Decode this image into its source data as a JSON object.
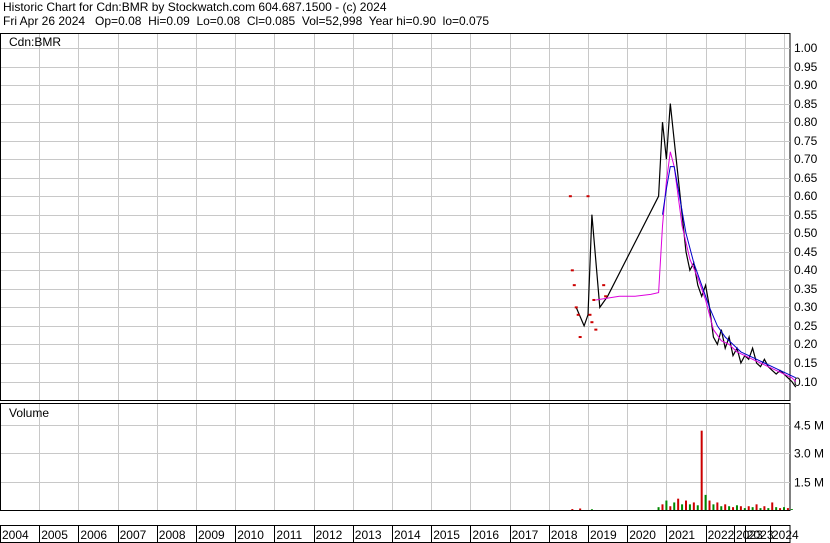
{
  "header": {
    "line1": "Historic Chart for Cdn:BMR by Stockwatch.com 604.687.1500 - (c) 2024",
    "line2": "Fri Apr 26 2024   Op=0.08  Hi=0.09  Lo=0.08  Cl=0.085  Vol=52,998  Year hi=0.90  lo=0.075"
  },
  "chart_data": [
    {
      "type": "line",
      "title": "Cdn:BMR",
      "ylim": [
        0.05,
        1.0
      ],
      "y_ticks": [
        "1.00",
        "0.95",
        "0.90",
        "0.85",
        "0.80",
        "0.75",
        "0.70",
        "0.65",
        "0.60",
        "0.55",
        "0.50",
        "0.45",
        "0.40",
        "0.35",
        "0.30",
        "0.25",
        "0.20",
        "0.15",
        "0.10"
      ],
      "x_ticks": [
        "2004",
        "2005",
        "2006",
        "2007",
        "2008",
        "2009",
        "2010",
        "2011",
        "2012",
        "2013",
        "2014",
        "2015",
        "2016",
        "2017",
        "2018",
        "2019",
        "2020",
        "2021",
        "2022",
        "2023",
        "2023",
        "2024"
      ],
      "grid": true,
      "series": [
        {
          "color": "#000000",
          "x": [
            2018.7,
            2018.9,
            2019.0,
            2019.1,
            2019.3,
            2019.5,
            2020.8,
            2020.9,
            2021.0,
            2021.1,
            2021.2,
            2021.3,
            2021.4,
            2021.5,
            2021.6,
            2021.7,
            2021.8,
            2021.9,
            2022.0,
            2022.1,
            2022.2,
            2022.3,
            2022.4,
            2022.5,
            2022.6,
            2022.7,
            2022.8,
            2022.9,
            2023.0,
            2023.1,
            2023.2,
            2023.3,
            2023.4,
            2023.5,
            2023.6,
            2023.7,
            2023.8,
            2023.9,
            2024.0,
            2024.1,
            2024.2,
            2024.3
          ],
          "y": [
            0.3,
            0.25,
            0.28,
            0.55,
            0.3,
            0.33,
            0.6,
            0.8,
            0.7,
            0.85,
            0.75,
            0.65,
            0.55,
            0.45,
            0.4,
            0.42,
            0.36,
            0.33,
            0.36,
            0.3,
            0.22,
            0.2,
            0.24,
            0.19,
            0.22,
            0.17,
            0.19,
            0.15,
            0.17,
            0.16,
            0.19,
            0.15,
            0.14,
            0.16,
            0.14,
            0.13,
            0.12,
            0.13,
            0.12,
            0.11,
            0.1,
            0.085
          ]
        },
        {
          "color": "#dd00dd",
          "x": [
            2019.2,
            2019.5,
            2019.8,
            2020.2,
            2020.6,
            2020.8,
            2020.9,
            2021.0,
            2021.1,
            2021.2,
            2021.4,
            2021.6,
            2021.8,
            2022.0,
            2022.2,
            2022.4,
            2022.6,
            2022.8,
            2023.0,
            2023.2,
            2023.4,
            2023.6,
            2023.8,
            2024.0,
            2024.2,
            2024.3
          ],
          "y": [
            0.32,
            0.325,
            0.33,
            0.33,
            0.335,
            0.34,
            0.52,
            0.64,
            0.72,
            0.68,
            0.52,
            0.43,
            0.38,
            0.32,
            0.24,
            0.21,
            0.2,
            0.18,
            0.17,
            0.16,
            0.15,
            0.14,
            0.13,
            0.12,
            0.11,
            0.1
          ]
        },
        {
          "color": "#0000cc",
          "x": [
            2020.9,
            2021.0,
            2021.1,
            2021.2,
            2021.3,
            2021.5,
            2021.7,
            2021.9,
            2022.1,
            2022.3,
            2022.5,
            2022.7,
            2022.9,
            2023.1,
            2023.3,
            2023.5,
            2023.7,
            2023.9,
            2024.1,
            2024.3
          ],
          "y": [
            0.55,
            0.62,
            0.68,
            0.68,
            0.62,
            0.5,
            0.42,
            0.36,
            0.3,
            0.25,
            0.22,
            0.2,
            0.18,
            0.17,
            0.16,
            0.15,
            0.14,
            0.13,
            0.12,
            0.11
          ]
        }
      ],
      "markers": {
        "color": "#cc0000",
        "x": [
          2018.55,
          2018.6,
          2018.65,
          2018.7,
          2018.75,
          2018.8,
          2019.0,
          2019.05,
          2019.1,
          2019.15,
          2019.2,
          2019.4,
          2019.45
        ],
        "y": [
          0.6,
          0.4,
          0.36,
          0.3,
          0.28,
          0.22,
          0.6,
          0.28,
          0.26,
          0.32,
          0.24,
          0.36,
          0.33
        ]
      }
    },
    {
      "type": "bar",
      "title": "Volume",
      "y_ticks": [
        "4.5 M",
        "3.0 M",
        "1.5 M"
      ],
      "ylim": [
        0,
        5.6
      ],
      "x": [
        2018.6,
        2018.8,
        2019.1,
        2020.8,
        2020.9,
        2021.0,
        2021.1,
        2021.2,
        2021.3,
        2021.4,
        2021.5,
        2021.6,
        2021.7,
        2021.8,
        2021.9,
        2022.0,
        2022.1,
        2022.2,
        2022.3,
        2022.4,
        2022.5,
        2022.6,
        2022.7,
        2022.8,
        2022.9,
        2023.0,
        2023.1,
        2023.2,
        2023.3,
        2023.4,
        2023.5,
        2023.6,
        2023.7,
        2023.8,
        2023.9,
        2024.0,
        2024.1,
        2024.2
      ],
      "values": [
        0.05,
        0.08,
        0.04,
        0.15,
        0.3,
        0.5,
        0.2,
        0.4,
        0.6,
        0.3,
        0.5,
        0.3,
        0.4,
        0.25,
        4.2,
        0.8,
        0.5,
        0.3,
        0.4,
        0.2,
        0.3,
        0.2,
        0.15,
        0.25,
        0.2,
        0.1,
        0.2,
        0.15,
        0.3,
        0.1,
        0.2,
        0.1,
        0.4,
        0.15,
        0.1,
        0.15,
        0.1,
        0.05
      ],
      "colors": [
        "#cc0000",
        "#cc0000",
        "#008800",
        "#008800",
        "#cc0000",
        "#008800",
        "#cc0000",
        "#008800",
        "#cc0000",
        "#008800",
        "#cc0000",
        "#008800",
        "#cc0000",
        "#008800",
        "#cc0000",
        "#008800",
        "#cc0000",
        "#008800",
        "#cc0000",
        "#008800",
        "#cc0000",
        "#008800",
        "#cc0000",
        "#008800",
        "#cc0000",
        "#008800",
        "#cc0000",
        "#008800",
        "#cc0000",
        "#008800",
        "#cc0000",
        "#008800",
        "#cc0000",
        "#008800",
        "#cc0000",
        "#008800",
        "#cc0000",
        "#008800"
      ]
    }
  ]
}
